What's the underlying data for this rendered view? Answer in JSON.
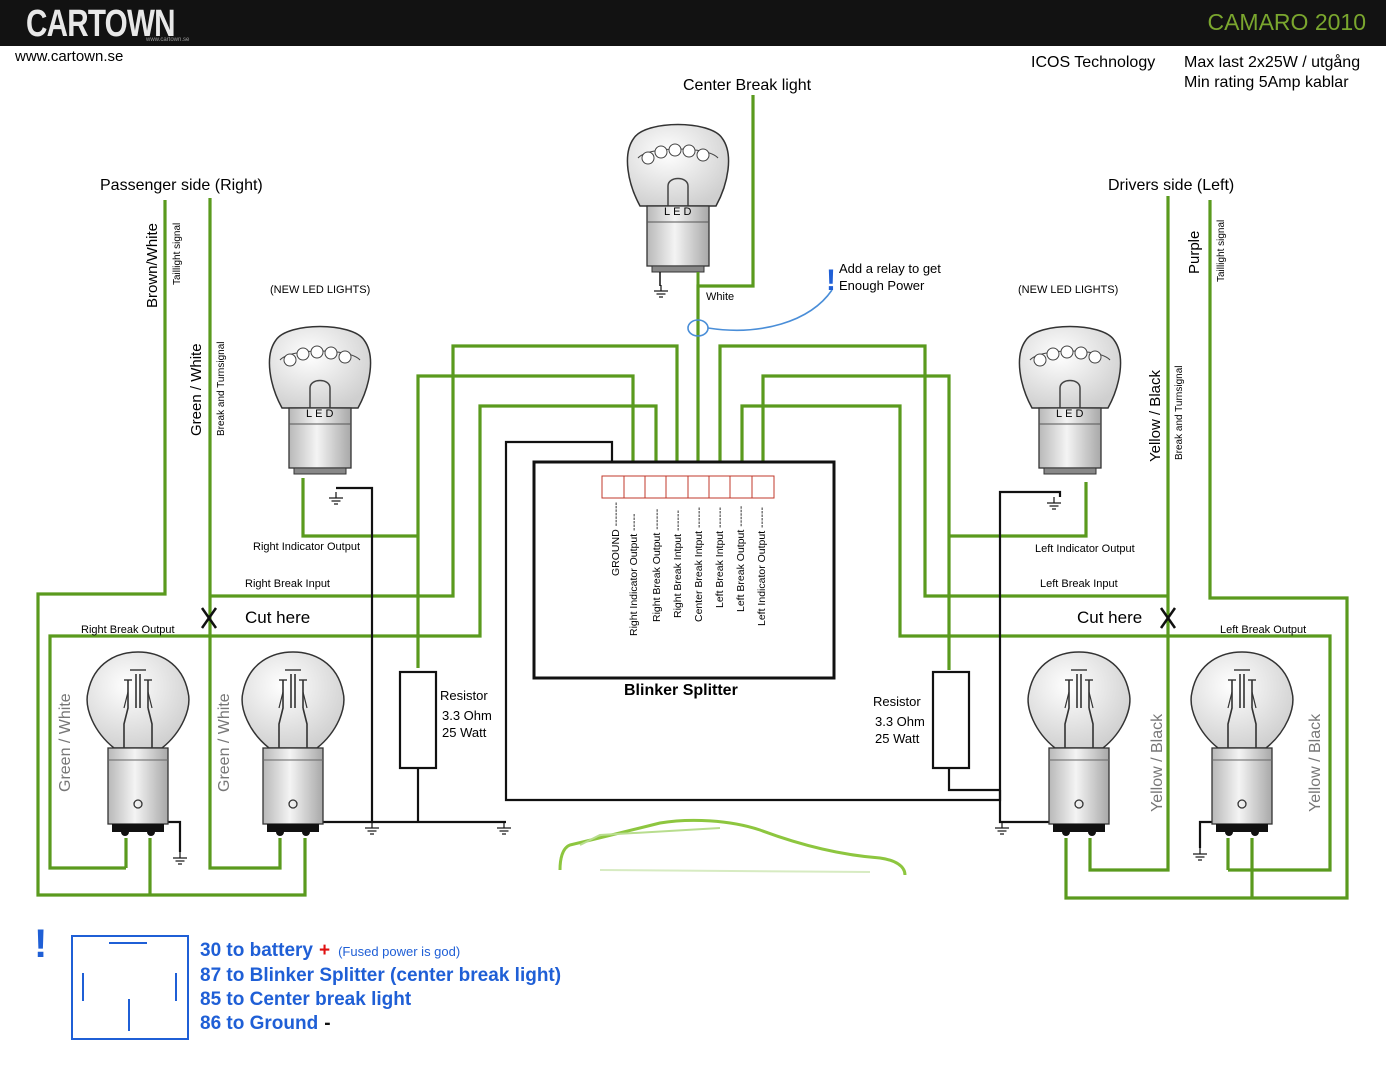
{
  "header": {
    "logo_text": "CARTOWN",
    "logo_subtext": "www.cartown.se",
    "model": "CAMARO 2010",
    "website": "www.cartown.se"
  },
  "top_notes": {
    "technology": "ICOS Technology",
    "max_load": "Max last 2x25W / utgång",
    "min_rating": "Min rating 5Amp kablar"
  },
  "colors": {
    "wire_green": "#5a9a1e",
    "wire_black": "#111111",
    "relay_blue": "#1f5fd6",
    "brand_green": "#7aa62e"
  },
  "labels": {
    "center_break_light": "Center Break light",
    "passenger_side": "Passenger side (Right)",
    "drivers_side": "Drivers side (Left)",
    "new_led_lights": "(NEW LED LIGHTS)",
    "led": "LED",
    "white": "White",
    "brown_white": "Brown/White",
    "taillight_signal": "Taillight signal",
    "green_white": "Green / White",
    "break_turnsignal": "Break and Turnsignal",
    "purple": "Purple",
    "yellow_black": "Yellow / Black",
    "relay_note_line1": "Add a relay to get",
    "relay_note_line2": "Enough Power",
    "right_indicator_output": "Right Indicator Output",
    "right_break_input": "Right Break Input",
    "right_break_output": "Right Break Output",
    "left_indicator_output": "Left Indicator Output",
    "left_break_input": "Left Break Input",
    "left_break_output": "Left Break Output",
    "cut_here": "Cut here",
    "resistor": "Resistor",
    "resistor_ohm": "3.3 Ohm",
    "resistor_watt": "25 Watt",
    "blinker_splitter": "Blinker Splitter"
  },
  "splitter_pins": [
    "GROUND -------",
    "Right Indicator Output -----",
    "Right Break Output ------",
    "Right Break Intput ------",
    "Center Break Intput ------",
    "Left Break Intput ------",
    "Left Break Output ------",
    "Left Indicator Output ------"
  ],
  "relay_legend": {
    "line1": "30 to battery",
    "line1_sign": "+",
    "line1_note": "(Fused power is god)",
    "line2": "87 to Blinker Splitter (center break light)",
    "line3": "85 to Center break light",
    "line4": "86 to Ground",
    "line4_sign": "-"
  }
}
